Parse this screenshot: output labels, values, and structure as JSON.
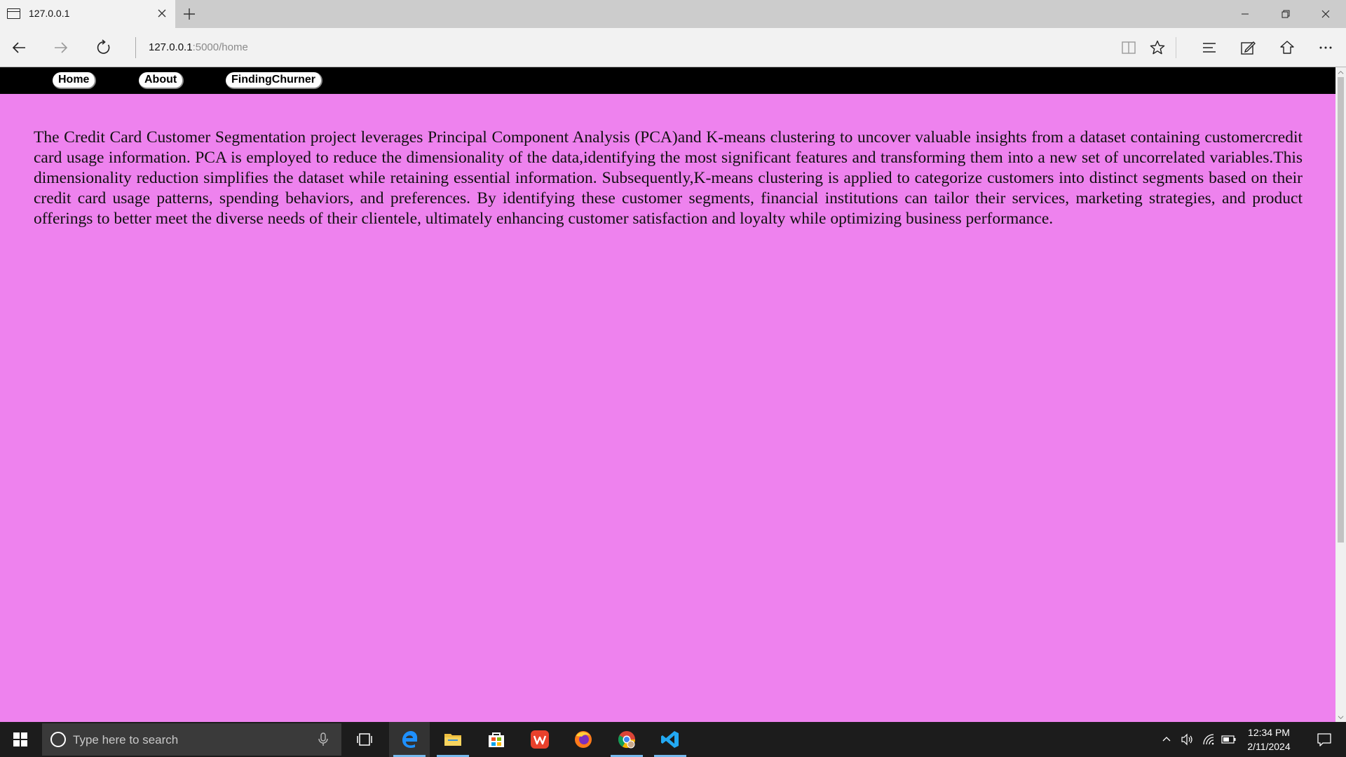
{
  "browser": {
    "tab_title": "127.0.0.1",
    "url_host": "127.0.0.1",
    "url_rest": ":5000/home"
  },
  "site": {
    "nav": [
      {
        "label": "Home"
      },
      {
        "label": "About"
      },
      {
        "label": "FindingChurner"
      }
    ],
    "background_color": "#ee82ee",
    "nav_background": "#000000",
    "body_text": "The Credit Card Customer Segmentation project leverages Principal Component Analysis (PCA)and K-means clustering to uncover valuable insights from a dataset containing customercredit card usage information. PCA is employed to reduce the dimensionality of the data,identifying the most significant features and transforming them into a new set of uncorrelated variables.This dimensionality reduction simplifies the dataset while retaining essential information. Subsequently,K-means clustering is applied to categorize customers into distinct segments based on their credit card usage patterns, spending behaviors, and preferences. By identifying these customer segments, financial institutions can tailor their services, marketing strategies, and product offerings to better meet the diverse needs of their clientele, ultimately enhancing customer satisfaction and loyalty while optimizing business performance."
  },
  "taskbar": {
    "search_placeholder": "Type here to search",
    "time": "12:34 PM",
    "date": "2/11/2024",
    "apps": [
      "edge-icon",
      "file-explorer-icon",
      "store-icon",
      "wps-office-icon",
      "firefox-icon",
      "chrome-icon",
      "vscode-icon"
    ]
  }
}
